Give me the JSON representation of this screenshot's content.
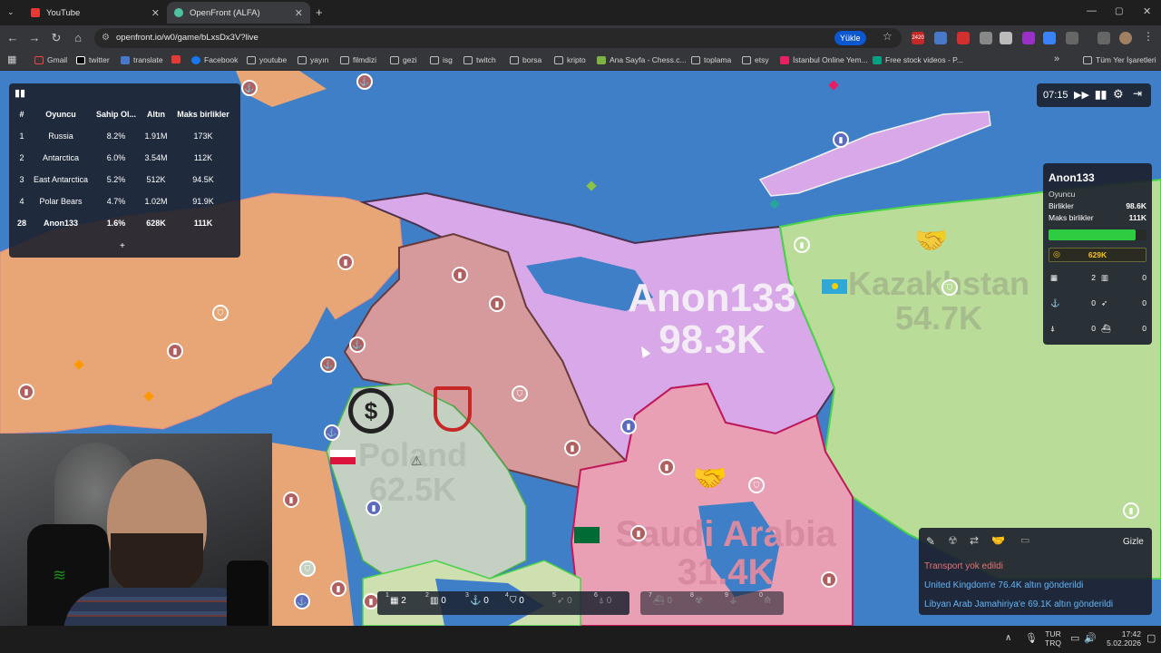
{
  "browser": {
    "tabs": [
      {
        "title": "YouTube",
        "active": false
      },
      {
        "title": "OpenFront (ALFA)",
        "active": true
      }
    ],
    "url": "openfront.io/w0/game/bLxsDx3V?live",
    "upload_label": "Yükle",
    "ext_badge": "2420",
    "bookmarks": [
      "Gmail",
      "twitter",
      "translate",
      "Facebook",
      "youtube",
      "yayın",
      "filmdizi",
      "gezi",
      "isg",
      "twitch",
      "borsa",
      "kripto",
      "Ana Sayfa - Chess.c...",
      "toplama",
      "etsy",
      "İstanbul Online Yem...",
      "Free stock videos - P..."
    ],
    "all_bookmarks": "Tüm Yer İşaretleri"
  },
  "leaderboard": {
    "headers": [
      "#",
      "Oyuncu",
      "Sahip Ol...",
      "Altın",
      "Maks birlikler"
    ],
    "rows": [
      {
        "rank": "1",
        "player": "Russia",
        "owned": "8.2%",
        "gold": "1.91M",
        "max_troops": "173K"
      },
      {
        "rank": "2",
        "player": "Antarctica",
        "owned": "6.0%",
        "gold": "3.54M",
        "max_troops": "112K"
      },
      {
        "rank": "3",
        "player": "East Antarctica",
        "owned": "5.2%",
        "gold": "512K",
        "max_troops": "94.5K"
      },
      {
        "rank": "4",
        "player": "Polar Bears",
        "owned": "4.7%",
        "gold": "1.02M",
        "max_troops": "91.9K"
      },
      {
        "rank": "28",
        "player": "Anon133",
        "owned": "1.6%",
        "gold": "628K",
        "max_troops": "111K"
      }
    ],
    "expand": "+"
  },
  "game_time": "07:15",
  "map_labels": {
    "anon_name": "Anon133",
    "anon_troops": "98.3K",
    "kaz_name": "Kazakhstan",
    "kaz_troops": "54.7K",
    "pol_name": "Poland",
    "pol_troops": "62.5K",
    "sa_name": "Saudi Arabia",
    "sa_troops": "31.4K"
  },
  "player_card": {
    "name": "Anon133",
    "type": "Oyuncu",
    "troops_label": "Birlikler",
    "troops": "98.6K",
    "max_label": "Maks birlikler",
    "max": "111K",
    "troop_fill": 0.89,
    "gold": "629K",
    "stats": [
      {
        "icon": "city-icon",
        "value": "2"
      },
      {
        "icon": "factory-icon",
        "value": "0"
      },
      {
        "icon": "port-icon",
        "value": "0"
      },
      {
        "icon": "missile-icon",
        "value": "0"
      },
      {
        "icon": "sam-icon",
        "value": "0"
      },
      {
        "icon": "warship-icon",
        "value": "0"
      }
    ]
  },
  "events": {
    "hide_label": "Gizle",
    "messages": [
      {
        "text": "Transport yok edildi",
        "color": "#e57373"
      },
      {
        "text": "United Kingdom'e 76.4K altın gönderildi",
        "color": "#64b5f6"
      },
      {
        "text": "Libyan Arab Jamahiriya'e 69.1K altın gönderildi",
        "color": "#64b5f6"
      }
    ]
  },
  "toolbar": [
    {
      "key": "1",
      "icon": "city-icon",
      "count": "2",
      "dim": false
    },
    {
      "key": "2",
      "icon": "factory-icon",
      "count": "0",
      "dim": false
    },
    {
      "key": "3",
      "icon": "port-icon",
      "count": "0",
      "dim": false
    },
    {
      "key": "4",
      "icon": "defense-post-icon",
      "count": "0",
      "dim": false
    },
    {
      "key": "5",
      "icon": "missile-silo-icon",
      "count": "0",
      "dim": true
    },
    {
      "key": "6",
      "icon": "sam-launcher-icon",
      "count": "0",
      "dim": true
    }
  ],
  "toolbar2": [
    {
      "key": "7",
      "icon": "warship-icon",
      "count": "0"
    },
    {
      "key": "8",
      "icon": "atom-bomb-icon",
      "count": ""
    },
    {
      "key": "9",
      "icon": "hydrogen-bomb-icon",
      "count": ""
    },
    {
      "key": "0",
      "icon": "mirv-icon",
      "count": ""
    }
  ],
  "taskbar": {
    "lang1": "TUR",
    "lang2": "TRQ",
    "time": "17:42",
    "date": "5.02.2026"
  },
  "colors": {
    "sea": "#3e7fc7",
    "anon": "#d9a8e8",
    "russia_west": "#d69a9c",
    "kazakhstan": "#b9dc98",
    "saudi": "#eaa0b4",
    "orange_land": "#e8a576",
    "poland": "#c4d0c2"
  }
}
